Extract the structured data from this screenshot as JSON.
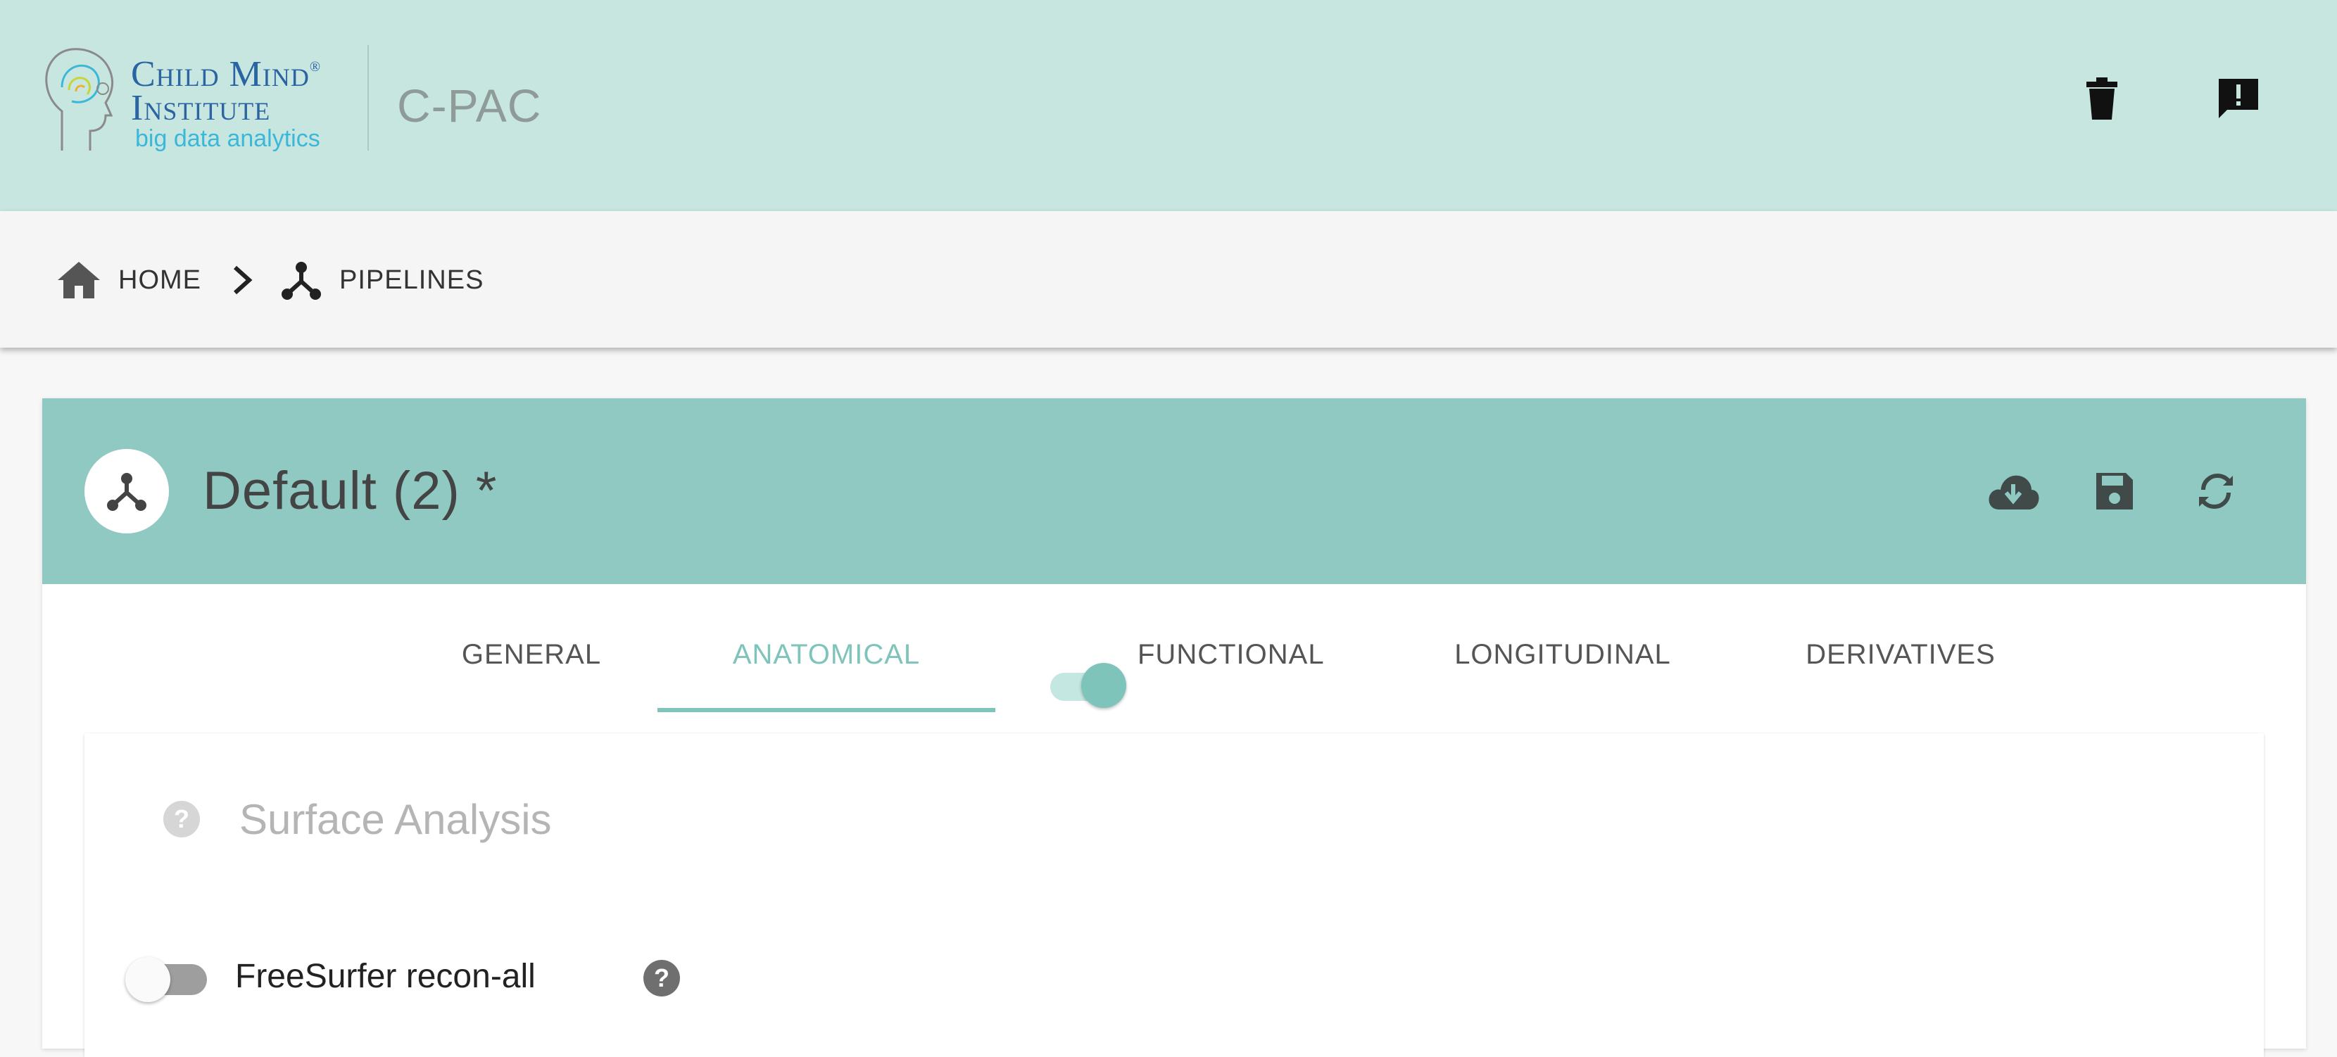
{
  "header": {
    "logo": {
      "line1": "Child Mind",
      "reg": "®",
      "line2": "Institute",
      "line3": "big data analytics"
    },
    "app_title": "C-PAC",
    "actions": [
      {
        "icon": "trash-icon"
      },
      {
        "icon": "feedback-icon"
      }
    ]
  },
  "breadcrumb": {
    "items": [
      {
        "label": "HOME",
        "icon": "home-icon"
      },
      {
        "label": "PIPELINES",
        "icon": "pipeline-icon"
      }
    ],
    "separator_icon": "chevron-right-icon"
  },
  "pipeline": {
    "title": "Default (2) *",
    "avatar_icon": "pipeline-icon",
    "actions": [
      {
        "icon": "cloud-download-icon"
      },
      {
        "icon": "save-icon"
      },
      {
        "icon": "sync-icon"
      }
    ]
  },
  "tabs": {
    "items": [
      {
        "label": "GENERAL",
        "active": false
      },
      {
        "label": "ANATOMICAL",
        "active": true
      },
      {
        "label": "FUNCTIONAL",
        "active": false,
        "toggle_on": true
      },
      {
        "label": "LONGITUDINAL",
        "active": false
      },
      {
        "label": "DERIVATIVES",
        "active": false
      }
    ]
  },
  "section": {
    "title": "Surface Analysis",
    "help_glyph": "?",
    "options": [
      {
        "label": "FreeSurfer recon-all",
        "enabled": false,
        "help_glyph": "?"
      }
    ]
  },
  "colors": {
    "header_bg": "#c8e6e0",
    "card_header_bg": "#8fc9c2",
    "accent": "#7fc4bb",
    "logo_blue": "#2a64a2",
    "logo_cyan": "#3ab7d9"
  }
}
